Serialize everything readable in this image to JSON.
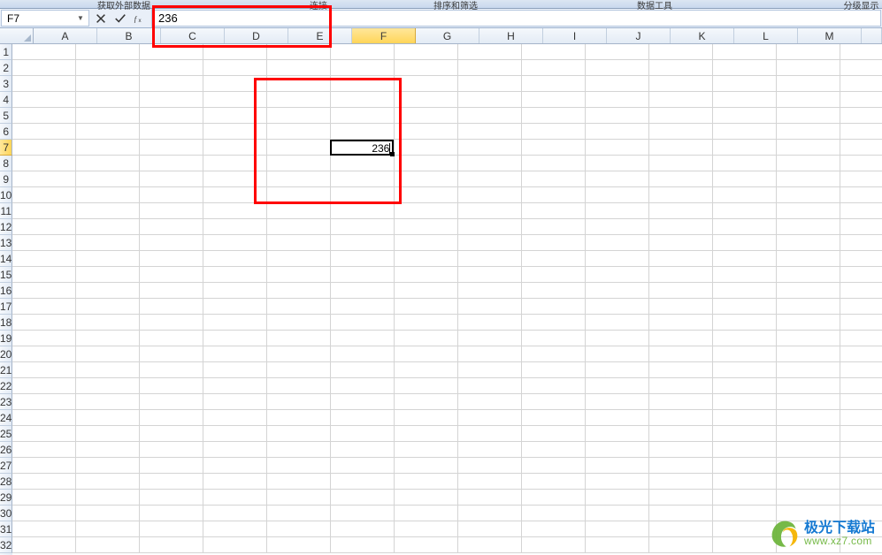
{
  "ribbon": {
    "groups": [
      "获取外部数据",
      "连接",
      "排序和筛选",
      "数据工具",
      "分级显示"
    ]
  },
  "nameBox": {
    "value": "F7"
  },
  "formulaBar": {
    "cancelTitle": "取消",
    "enterTitle": "输入",
    "fxTitle": "插入函数",
    "value": "236"
  },
  "columns": [
    "A",
    "B",
    "C",
    "D",
    "E",
    "F",
    "G",
    "H",
    "I",
    "J",
    "K",
    "L",
    "M"
  ],
  "activeCol": "F",
  "rows": 32,
  "activeRow": 7,
  "activeCell": {
    "col": "F",
    "row": 7,
    "value": "236"
  },
  "watermark": {
    "title": "极光下载站",
    "url": "www.xz7.com"
  }
}
